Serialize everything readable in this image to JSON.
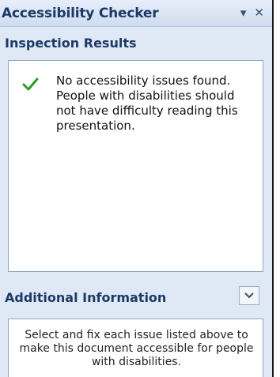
{
  "pane": {
    "title": "Accessibility Checker",
    "menu_glyph": "▾",
    "close_glyph": "✕"
  },
  "inspection": {
    "header": "Inspection Results",
    "message": "No accessibility issues found. People with disabilities should not have difficulty reading this presentation.",
    "status_icon": "checkmark-icon"
  },
  "additional_info": {
    "header": "Additional Information",
    "text": "Select and fix each issue listed above to make this document accessible for people with disabilities.",
    "expand_icon": "chevron-down-icon"
  },
  "colors": {
    "pane_background": "#dfe8f5",
    "header_text": "#1d3a66",
    "check_green": "#2e9a2e"
  }
}
